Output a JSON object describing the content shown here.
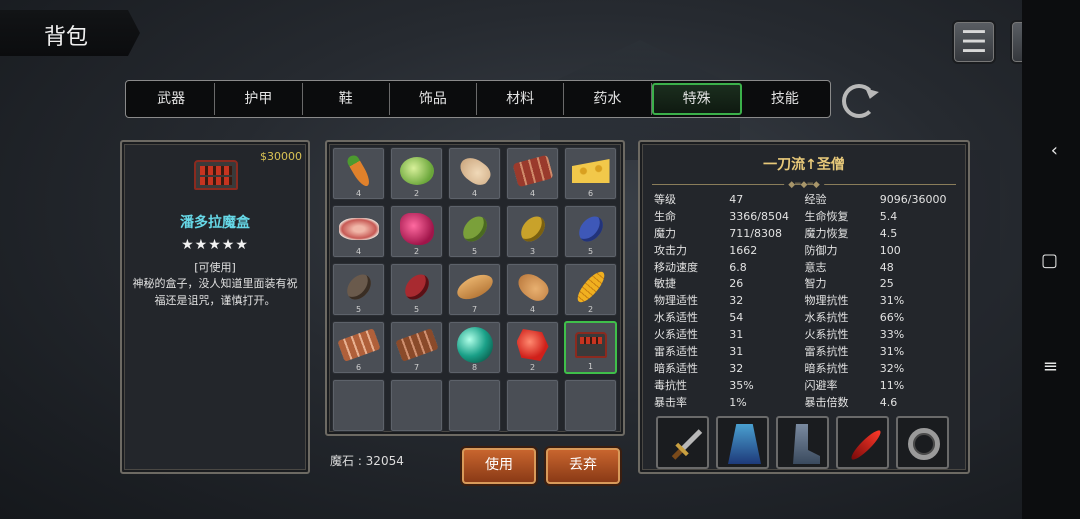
{
  "header": {
    "title": "背包"
  },
  "tabs": [
    "武器",
    "护甲",
    "鞋",
    "饰品",
    "材料",
    "药水",
    "特殊",
    "技能"
  ],
  "active_tab": "特殊",
  "item_detail": {
    "price": "$30000",
    "name": "潘多拉魔盒",
    "stars": "★★★★★",
    "usable": "[可使用]",
    "description": "神秘的盒子，没人知道里面装有祝福还是诅咒，谨慎打开。"
  },
  "inventory": {
    "slots": [
      {
        "icon": "carrot-icon",
        "count": "4"
      },
      {
        "icon": "cabbage-icon",
        "count": "2"
      },
      {
        "icon": "drumstick-icon",
        "count": "4"
      },
      {
        "icon": "ribs-icon",
        "count": "4"
      },
      {
        "icon": "cheese-icon",
        "count": "6"
      },
      {
        "icon": "steak-icon",
        "count": "4"
      },
      {
        "icon": "red-meat-icon",
        "count": "2"
      },
      {
        "icon": "green-bean-icon",
        "count": "5"
      },
      {
        "icon": "yellow-bean-icon",
        "count": "3"
      },
      {
        "icon": "blue-bean-icon",
        "count": "5"
      },
      {
        "icon": "dark-bean-icon",
        "count": "5"
      },
      {
        "icon": "red-bean-icon",
        "count": "5"
      },
      {
        "icon": "bread-icon",
        "count": "7"
      },
      {
        "icon": "drumstick-icon",
        "count": "4"
      },
      {
        "icon": "corn-icon",
        "count": "2"
      },
      {
        "icon": "meat-plank-icon",
        "count": "6"
      },
      {
        "icon": "meat-plank-icon",
        "count": "7"
      },
      {
        "icon": "teal-orb-icon",
        "count": "8"
      },
      {
        "icon": "red-crystal-icon",
        "count": "2"
      },
      {
        "icon": "pandora-box-icon",
        "count": "1"
      }
    ],
    "magic_stone": "魔石 : 32054",
    "use_label": "使用",
    "discard_label": "丢弃"
  },
  "character": {
    "title": "一刀流↑圣僧",
    "stats": [
      [
        "等级",
        "47",
        "经验",
        "9096/36000"
      ],
      [
        "生命",
        "3366/8504",
        "生命恢复",
        "5.4"
      ],
      [
        "魔力",
        "711/8308",
        "魔力恢复",
        "4.5"
      ],
      [
        "攻击力",
        "1662",
        "防御力",
        "100"
      ],
      [
        "移动速度",
        "6.8",
        "意志",
        "48"
      ],
      [
        "敏捷",
        "26",
        "智力",
        "25"
      ],
      [
        "物理适性",
        "32",
        "物理抗性",
        "31%"
      ],
      [
        "水系适性",
        "54",
        "水系抗性",
        "66%"
      ],
      [
        "火系适性",
        "31",
        "火系抗性",
        "33%"
      ],
      [
        "雷系适性",
        "31",
        "雷系抗性",
        "31%"
      ],
      [
        "暗系适性",
        "32",
        "暗系抗性",
        "32%"
      ],
      [
        "毒抗性",
        "35%",
        "闪避率",
        "11%"
      ],
      [
        "暴击率",
        "1%",
        "暴击倍数",
        "4.6"
      ]
    ],
    "equipment": [
      "sword-icon",
      "robe-icon",
      "boot-icon",
      "feather-icon",
      "ring-icon"
    ]
  }
}
